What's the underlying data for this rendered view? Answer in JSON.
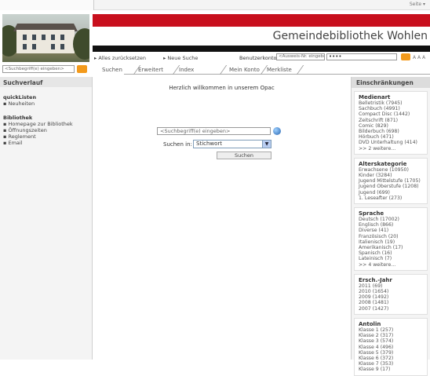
{
  "header": {
    "title": "Gemeindebibliothek Wohlen",
    "top_links": [
      "Alles zurücksetzen",
      "Neue Suche"
    ],
    "benutzerkonto_label": "Benutzerkonto",
    "account_placeholder": "<Ausweis-Nr. eingeben>",
    "password_value": "••••",
    "font_sizes": "A A A",
    "tools": "Seite ▾"
  },
  "quick_search": {
    "placeholder": "<Suchbegriff(e) eingeben>"
  },
  "tabs": [
    "Suchen",
    "Erweitert",
    "Index",
    "Mein Konto",
    "Merkliste"
  ],
  "sidebar": {
    "heading": "Suchverlauf",
    "sections": [
      {
        "title": "quickListen",
        "items": [
          "Neuheiten"
        ]
      },
      {
        "title": "Bibliothek",
        "items": [
          "Homepage zur Bibliothek",
          "Öffnungszeiten",
          "Reglement",
          "Email"
        ]
      }
    ]
  },
  "main": {
    "welcome": "Herzlich willkommen in unserem Opac",
    "search_placeholder": "<Suchbegriff(e) eingeben>",
    "search_in_label": "Suchen in:",
    "search_in_value": "Stichwort",
    "search_button": "Suchen"
  },
  "facets": {
    "heading": "Einschränkungen",
    "groups": [
      {
        "title": "Medienart",
        "items": [
          "Belletristik (7945)",
          "Sachbuch (4991)",
          "Compact Disc (1442)",
          "Zeitschrift (871)",
          "Comic (829)",
          "Bilderbuch (698)",
          "Hörbuch (471)",
          "DVD Unterhaltung (414)",
          ">> 2 weitere..."
        ]
      },
      {
        "title": "Alterskategorie",
        "items": [
          "Erwachsene (10950)",
          "Kinder (3284)",
          "Jugend Mittelstufe (1705)",
          "Jugend Oberstufe (1208)",
          "Jugend (699)",
          "1. Leseafter (273)"
        ]
      },
      {
        "title": "Sprache",
        "items": [
          "Deutsch (17002)",
          "Englisch (866)",
          "Diverse (41)",
          "Französisch (20)",
          "Italienisch (19)",
          "Amerikanisch (17)",
          "Spanisch (16)",
          "Lateinisch (7)",
          ">> 4 weitere..."
        ]
      },
      {
        "title": "Ersch.-Jahr",
        "items": [
          "2011 (69)",
          "2010 (1654)",
          "2009 (1492)",
          "2008 (1481)",
          "2007 (1427)"
        ]
      },
      {
        "title": "Antolin",
        "items": [
          "Klasse 1 (257)",
          "Klasse 2 (317)",
          "Klasse 3 (574)",
          "Klasse 4 (496)",
          "Klasse 5 (379)",
          "Klasse 6 (372)",
          "Klasse 7 (353)",
          "Klasse 9 (17)"
        ]
      }
    ]
  },
  "colors": {
    "brand_red": "#c80f1d",
    "accent_orange": "#f39a1b",
    "select_blue": "#7f9db9"
  }
}
